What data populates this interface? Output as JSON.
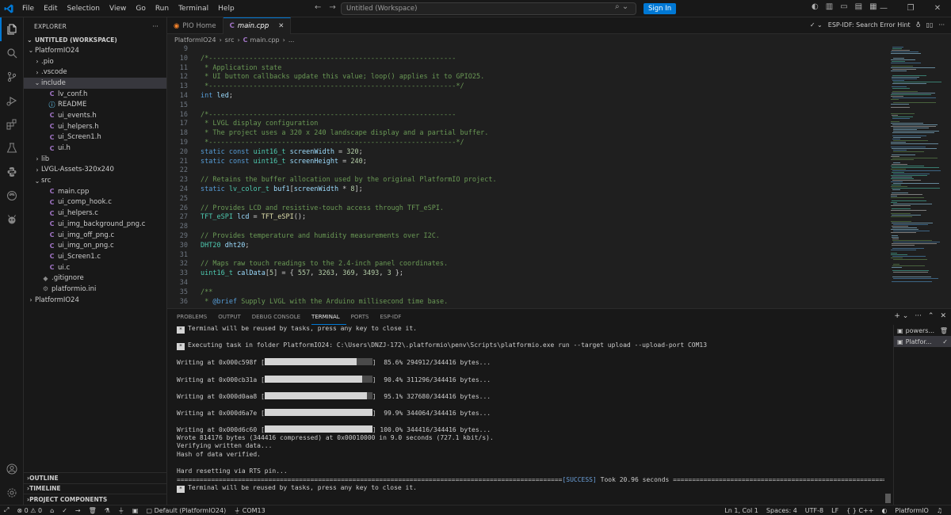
{
  "titlebar": {
    "menu": [
      "File",
      "Edit",
      "Selection",
      "View",
      "Go",
      "Run",
      "Terminal",
      "Help"
    ],
    "command_center": "Untitled (Workspace)",
    "sign_in": "Sign In"
  },
  "sidebar": {
    "title": "EXPLORER",
    "workspace": "UNTITLED (WORKSPACE)",
    "tree": [
      {
        "label": "PlatformIO24",
        "depth": 0,
        "kind": "folder-open"
      },
      {
        "label": ".pio",
        "depth": 1,
        "kind": "folder"
      },
      {
        "label": ".vscode",
        "depth": 1,
        "kind": "folder"
      },
      {
        "label": "include",
        "depth": 1,
        "kind": "folder-open"
      },
      {
        "label": "lv_conf.h",
        "depth": 2,
        "kind": "c"
      },
      {
        "label": "README",
        "depth": 2,
        "kind": "info"
      },
      {
        "label": "ui_events.h",
        "depth": 2,
        "kind": "c"
      },
      {
        "label": "ui_helpers.h",
        "depth": 2,
        "kind": "c"
      },
      {
        "label": "ui_Screen1.h",
        "depth": 2,
        "kind": "c"
      },
      {
        "label": "ui.h",
        "depth": 2,
        "kind": "c"
      },
      {
        "label": "lib",
        "depth": 1,
        "kind": "folder"
      },
      {
        "label": "LVGL-Assets-320x240",
        "depth": 1,
        "kind": "folder"
      },
      {
        "label": "src",
        "depth": 1,
        "kind": "folder-open"
      },
      {
        "label": "main.cpp",
        "depth": 2,
        "kind": "c"
      },
      {
        "label": "ui_comp_hook.c",
        "depth": 2,
        "kind": "c"
      },
      {
        "label": "ui_helpers.c",
        "depth": 2,
        "kind": "c"
      },
      {
        "label": "ui_img_background_png.c",
        "depth": 2,
        "kind": "c"
      },
      {
        "label": "ui_img_off_png.c",
        "depth": 2,
        "kind": "c"
      },
      {
        "label": "ui_img_on_png.c",
        "depth": 2,
        "kind": "c"
      },
      {
        "label": "ui_Screen1.c",
        "depth": 2,
        "kind": "c"
      },
      {
        "label": "ui.c",
        "depth": 2,
        "kind": "c"
      },
      {
        "label": ".gitignore",
        "depth": 1,
        "kind": "git"
      },
      {
        "label": "platformio.ini",
        "depth": 1,
        "kind": "ini"
      },
      {
        "label": "PlatformIO24",
        "depth": 0,
        "kind": "folder"
      }
    ],
    "bottom_sections": [
      "OUTLINE",
      "TIMELINE",
      "PROJECT COMPONENTS"
    ]
  },
  "tabs": [
    {
      "label": "PIO Home",
      "active": false
    },
    {
      "label": "main.cpp",
      "active": true
    }
  ],
  "editor_actions": {
    "hint": "ESP-IDF: Search Error Hint"
  },
  "breadcrumb": [
    "PlatformIO24",
    "src",
    "main.cpp",
    "..."
  ],
  "code": [
    {
      "n": "9",
      "parts": []
    },
    {
      "n": "10",
      "parts": [
        [
          "c",
          "/*-------------------------------------------------------------"
        ]
      ]
    },
    {
      "n": "11",
      "parts": [
        [
          "c",
          " * Application state"
        ]
      ]
    },
    {
      "n": "12",
      "parts": [
        [
          "c",
          " * UI button callbacks update this value; loop() applies it to GPIO25."
        ]
      ]
    },
    {
      "n": "13",
      "parts": [
        [
          "c",
          " *-------------------------------------------------------------*/"
        ]
      ]
    },
    {
      "n": "14",
      "parts": [
        [
          "k",
          "int"
        ],
        [
          "p",
          " "
        ],
        [
          "v",
          "led"
        ],
        [
          "p",
          ";"
        ]
      ]
    },
    {
      "n": "15",
      "parts": []
    },
    {
      "n": "16",
      "parts": [
        [
          "c",
          "/*-------------------------------------------------------------"
        ]
      ]
    },
    {
      "n": "17",
      "parts": [
        [
          "c",
          " * LVGL display configuration"
        ]
      ]
    },
    {
      "n": "18",
      "parts": [
        [
          "c",
          " * The project uses a 320 x 240 landscape display and a partial buffer."
        ]
      ]
    },
    {
      "n": "19",
      "parts": [
        [
          "c",
          " *-------------------------------------------------------------*/"
        ]
      ]
    },
    {
      "n": "20",
      "parts": [
        [
          "k",
          "static"
        ],
        [
          "p",
          " "
        ],
        [
          "k",
          "const"
        ],
        [
          "p",
          " "
        ],
        [
          "t",
          "uint16_t"
        ],
        [
          "p",
          " "
        ],
        [
          "v",
          "screenWidth"
        ],
        [
          "p",
          " = "
        ],
        [
          "n",
          "320"
        ],
        [
          "p",
          ";"
        ]
      ]
    },
    {
      "n": "21",
      "parts": [
        [
          "k",
          "static"
        ],
        [
          "p",
          " "
        ],
        [
          "k",
          "const"
        ],
        [
          "p",
          " "
        ],
        [
          "t",
          "uint16_t"
        ],
        [
          "p",
          " "
        ],
        [
          "v",
          "screenHeight"
        ],
        [
          "p",
          " = "
        ],
        [
          "n",
          "240"
        ],
        [
          "p",
          ";"
        ]
      ]
    },
    {
      "n": "22",
      "parts": []
    },
    {
      "n": "23",
      "parts": [
        [
          "c",
          "// Retains the buffer allocation used by the original PlatformIO project."
        ]
      ]
    },
    {
      "n": "24",
      "parts": [
        [
          "k",
          "static"
        ],
        [
          "p",
          " "
        ],
        [
          "t",
          "lv_color_t"
        ],
        [
          "p",
          " "
        ],
        [
          "v",
          "buf1"
        ],
        [
          "p",
          "["
        ],
        [
          "v",
          "screenWidth"
        ],
        [
          "p",
          " * "
        ],
        [
          "n",
          "8"
        ],
        [
          "p",
          "];"
        ]
      ]
    },
    {
      "n": "25",
      "parts": []
    },
    {
      "n": "26",
      "parts": [
        [
          "c",
          "// Provides LCD and resistive-touch access through TFT_eSPI."
        ]
      ]
    },
    {
      "n": "27",
      "parts": [
        [
          "t",
          "TFT_eSPI"
        ],
        [
          "p",
          " "
        ],
        [
          "v",
          "lcd"
        ],
        [
          "p",
          " = "
        ],
        [
          "f",
          "TFT_eSPI"
        ],
        [
          "p",
          "();"
        ]
      ]
    },
    {
      "n": "28",
      "parts": []
    },
    {
      "n": "29",
      "parts": [
        [
          "c",
          "// Provides temperature and humidity measurements over I2C."
        ]
      ]
    },
    {
      "n": "30",
      "parts": [
        [
          "t",
          "DHT20"
        ],
        [
          "p",
          " "
        ],
        [
          "v",
          "dht20"
        ],
        [
          "p",
          ";"
        ]
      ]
    },
    {
      "n": "31",
      "parts": []
    },
    {
      "n": "32",
      "parts": [
        [
          "c",
          "// Maps raw touch readings to the 2.4-inch panel coordinates."
        ]
      ]
    },
    {
      "n": "33",
      "parts": [
        [
          "t",
          "uint16_t"
        ],
        [
          "p",
          " "
        ],
        [
          "v",
          "calData"
        ],
        [
          "p",
          "["
        ],
        [
          "n",
          "5"
        ],
        [
          "p",
          "] = { "
        ],
        [
          "n",
          "557"
        ],
        [
          "p",
          ", "
        ],
        [
          "n",
          "3263"
        ],
        [
          "p",
          ", "
        ],
        [
          "n",
          "369"
        ],
        [
          "p",
          ", "
        ],
        [
          "n",
          "3493"
        ],
        [
          "p",
          ", "
        ],
        [
          "n",
          "3"
        ],
        [
          "p",
          " };"
        ]
      ]
    },
    {
      "n": "34",
      "parts": []
    },
    {
      "n": "35",
      "parts": [
        [
          "c",
          "/**"
        ]
      ]
    },
    {
      "n": "36",
      "parts": [
        [
          "c",
          " * "
        ],
        [
          "g",
          "@brief"
        ],
        [
          "c",
          " Supply LVGL with the Arduino millisecond time base."
        ]
      ]
    }
  ],
  "panel": {
    "tabs": [
      "PROBLEMS",
      "OUTPUT",
      "DEBUG CONSOLE",
      "TERMINAL",
      "PORTS",
      "ESP-IDF"
    ],
    "active_tab": "TERMINAL",
    "terminals": [
      "powers...",
      "Platfor..."
    ],
    "lines": [
      {
        "type": "star",
        "text": "Terminal will be reused by tasks, press any key to close it."
      },
      {
        "type": "blank"
      },
      {
        "type": "star",
        "text": "Executing task in folder PlatformIO24: C:\\Users\\DNZJ-172\\.platformio\\penv\\Scripts\\platformio.exe run --target upload --upload-port COM13"
      },
      {
        "type": "blank"
      },
      {
        "type": "progress",
        "prefix": "Writing at 0x000c598f [",
        "fill": 0.856,
        "suffix": "]  85.6% 294912/344416 bytes..."
      },
      {
        "type": "blank"
      },
      {
        "type": "progress",
        "prefix": "Writing at 0x000cb31a [",
        "fill": 0.904,
        "suffix": "]  90.4% 311296/344416 bytes..."
      },
      {
        "type": "blank"
      },
      {
        "type": "progress",
        "prefix": "Writing at 0x000d0aa8 [",
        "fill": 0.951,
        "suffix": "]  95.1% 327680/344416 bytes..."
      },
      {
        "type": "blank"
      },
      {
        "type": "progress",
        "prefix": "Writing at 0x000d6a7e [",
        "fill": 0.999,
        "suffix": "]  99.9% 344064/344416 bytes..."
      },
      {
        "type": "blank"
      },
      {
        "type": "progress",
        "prefix": "Writing at 0x000d6c60 [",
        "fill": 1.0,
        "suffix": "] 100.0% 344416/344416 bytes..."
      },
      {
        "type": "text",
        "text": "Wrote 814176 bytes (344416 compressed) at 0x00010000 in 9.0 seconds (727.1 kbit/s)."
      },
      {
        "type": "text",
        "text": "Verifying written data..."
      },
      {
        "type": "text",
        "text": "Hash of data verified."
      },
      {
        "type": "blank"
      },
      {
        "type": "text",
        "text": "Hard resetting via RTS pin..."
      },
      {
        "type": "success",
        "left": "=====================================================================================================",
        "mid": "[SUCCESS]",
        "right": " Took 20.96 seconds ===================================================================================================="
      },
      {
        "type": "star",
        "text": "Terminal will be reused by tasks, press any key to close it."
      }
    ]
  },
  "statusbar": {
    "errors": "0",
    "warnings": "0",
    "env": "Default (PlatformIO24)",
    "port": "COM13",
    "position": "Ln 1, Col 1",
    "spaces": "Spaces: 4",
    "encoding": "UTF-8",
    "eol": "LF",
    "language": "C++",
    "platformio": "PlatformIO"
  },
  "colors": {
    "accent": "#0078d4",
    "background": "#1f1f1f",
    "chrome": "#181818"
  }
}
